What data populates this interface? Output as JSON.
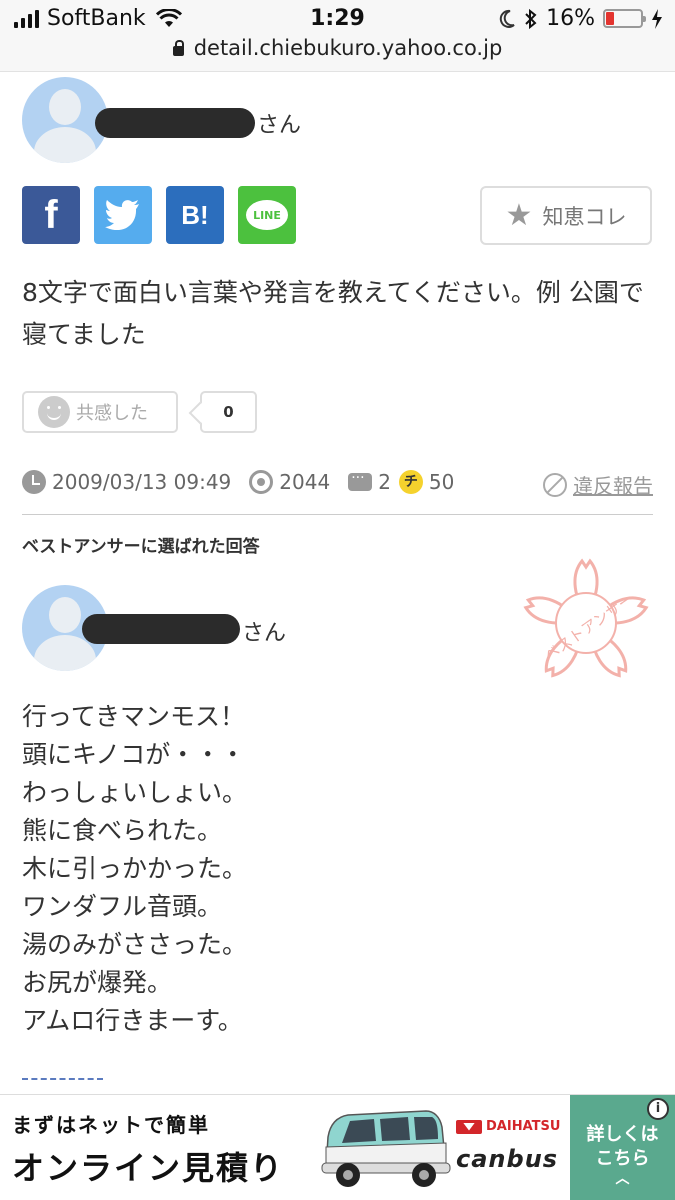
{
  "status_bar": {
    "carrier": "SoftBank",
    "time": "1:29",
    "battery_percent": "16%",
    "battery_level": 0.16,
    "battery_color": "#e3342f"
  },
  "browser": {
    "url": "detail.chiebukuro.yahoo.co.jp"
  },
  "question": {
    "author_suffix": "さん",
    "share_buttons": [
      {
        "name": "facebook",
        "label": "f",
        "color": "#3b5998"
      },
      {
        "name": "twitter",
        "label": "",
        "color": "#55acee"
      },
      {
        "name": "hatena-bookmark",
        "label": "B!",
        "color": "#2c6ebd"
      },
      {
        "name": "line",
        "label": "LINE",
        "color": "#4cc13e"
      }
    ],
    "collect_label": "知恵コレ",
    "text": "8文字で面白い言葉や発言を教えてください。例 公園で寝てました",
    "empathy_label": "共感した",
    "empathy_count": "0",
    "date": "2009/03/13 09:49",
    "views": "2044",
    "answers": "2",
    "coins_icon": "チ",
    "coins": "50",
    "report_label": "違反報告"
  },
  "best_answer": {
    "heading": "ベストアンサーに選ばれた回答",
    "author_suffix": "さん",
    "stamp_text": "ベストアンサー",
    "stamp_color": "#f3b1aa",
    "lines": [
      "行ってきマンモス！",
      "頭にキノコが・・・",
      "わっしょいしょい。",
      "熊に食べられた。",
      "木に引っかかった。",
      "ワンダフル音頭。",
      "湯のみがささった。",
      "お尻が爆発。",
      "アムロ行きまーす。"
    ]
  },
  "ad": {
    "line1": "まずはネットで簡単",
    "line2": "オンライン見積り",
    "maker": "DAIHATSU",
    "model": "canbus",
    "cta": [
      "詳しくは",
      "こちら"
    ],
    "cta_color": "#5aa98e",
    "info_icon": "i"
  }
}
